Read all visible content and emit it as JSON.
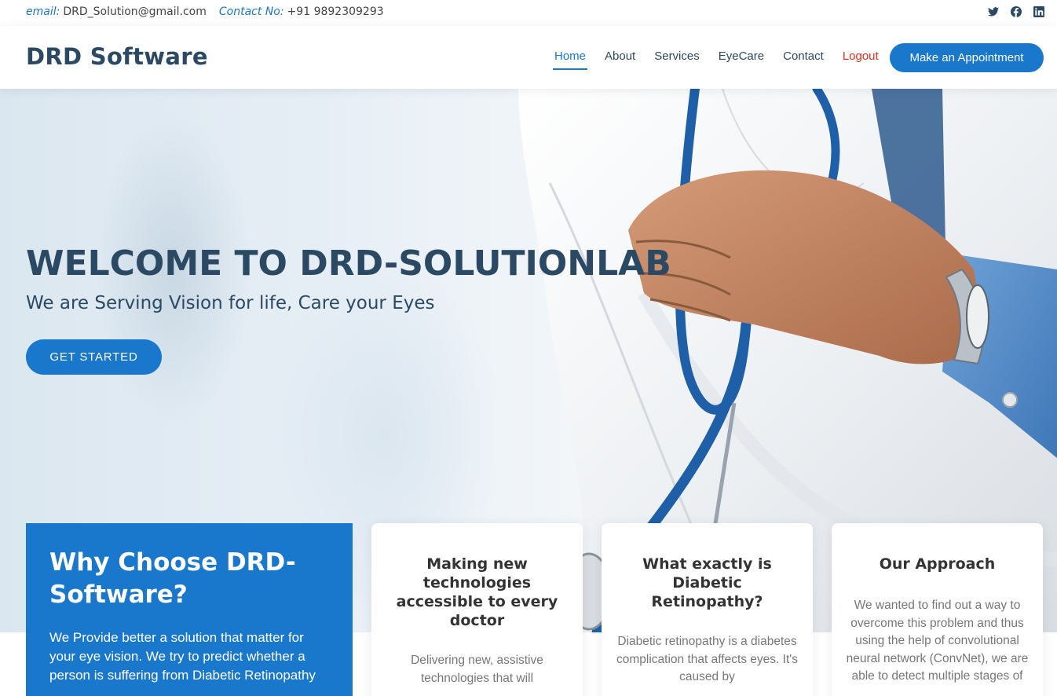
{
  "topbar": {
    "email_label": "email:",
    "email_value": "DRD_Solution@gmail.com",
    "contact_label": "Contact No:",
    "contact_value": "+91 9892309293",
    "socials": [
      "twitter-icon",
      "facebook-icon",
      "linkedin-icon"
    ]
  },
  "header": {
    "logo": "DRD Software",
    "nav": [
      "Home",
      "About",
      "Services",
      "EyeCare",
      "Contact",
      "Logout"
    ],
    "appointment_button": "Make an Appointment"
  },
  "hero": {
    "title": "WELCOME TO DRD-SOLUTIONLAB",
    "subtitle": "We are Serving Vision for life, Care your Eyes",
    "cta": "GET STARTED"
  },
  "why": {
    "title": "Why Choose DRD-Software?",
    "text": "We Provide better a solution that matter for your eye vision. We try to predict whether a person is suffering from Diabetic Retinopathy"
  },
  "cards": [
    {
      "title": "Making new technologies accessible to every doctor",
      "text": "Delivering new, assistive technologies that will"
    },
    {
      "title": "What exactly is Diabetic Retinopathy?",
      "text": "Diabetic retinopathy is a diabetes complication that affects eyes. It's caused by"
    },
    {
      "title": "Our Approach",
      "text": "We wanted to find out a way to overcome this problem and thus using the help of convolutional neural network (ConvNet), we are able to detect multiple stages of"
    }
  ],
  "colors": {
    "accent": "#1977cc",
    "dark": "#2c4964",
    "logout": "#e0301e"
  }
}
